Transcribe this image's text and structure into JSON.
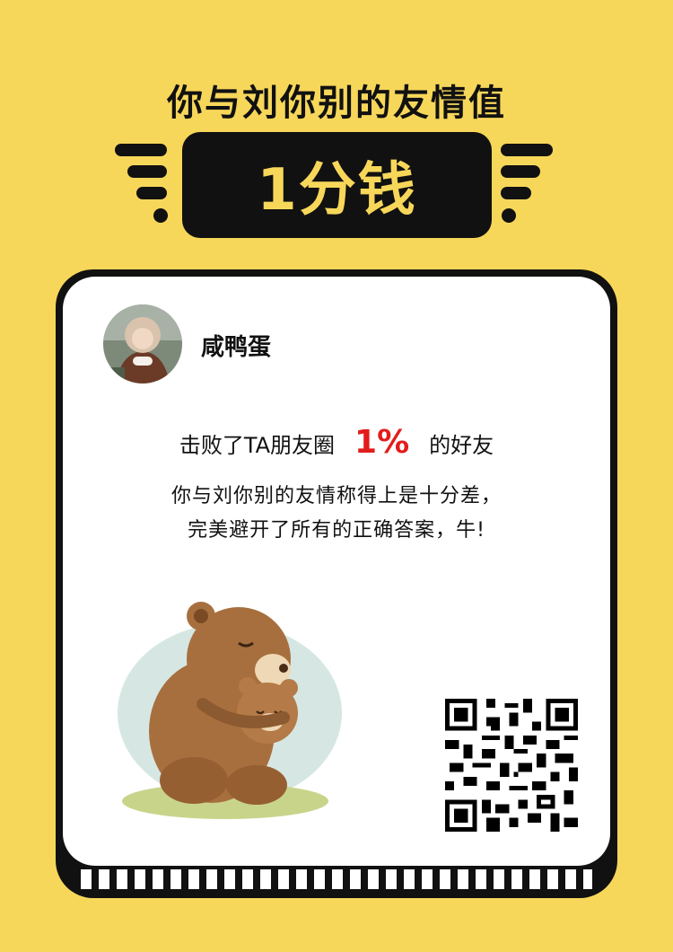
{
  "header": {
    "title": "你与刘你别的友情值",
    "score": "1分钱"
  },
  "card": {
    "user_name": "咸鸭蛋",
    "beat_prefix": "击败了TA朋友圈",
    "beat_percent": "1%",
    "beat_suffix": "的好友",
    "description_line1": "你与刘你别的友情称得上是十分差，",
    "description_line2": "完美避开了所有的正确答案，牛!"
  },
  "colors": {
    "background": "#f7d75a",
    "dark": "#111111",
    "highlight": "#e21c1c"
  },
  "icons": [
    "speed-lines-left-icon",
    "speed-lines-right-icon",
    "avatar",
    "bear-illustration",
    "qr-code"
  ]
}
